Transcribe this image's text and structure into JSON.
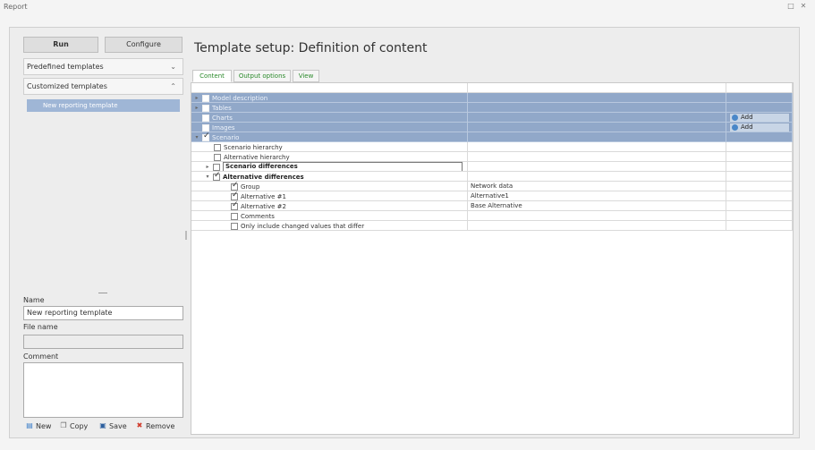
{
  "window": {
    "title": "Report",
    "restore_icon": "restore-icon",
    "close_icon": "close-icon"
  },
  "left": {
    "run_label": "Run",
    "configure_label": "Configure",
    "predefined_label": "Predefined templates",
    "customized_label": "Customized templates",
    "template_item": "New reporting template",
    "name_label": "Name",
    "name_value": "New reporting template",
    "filename_label": "File name",
    "filename_value": "",
    "comment_label": "Comment",
    "comment_value": "",
    "new_label": "New",
    "copy_label": "Copy",
    "save_label": "Save",
    "remove_label": "Remove"
  },
  "main": {
    "title": "Template setup: Definition of content",
    "tabs": [
      "Content",
      "Output options",
      "View"
    ],
    "add_label": "Add",
    "rows": [
      {
        "label": "Model description",
        "value": ""
      },
      {
        "label": "Tables",
        "value": ""
      },
      {
        "label": "Charts",
        "value": ""
      },
      {
        "label": "Images",
        "value": ""
      },
      {
        "label": "Scenario",
        "value": ""
      },
      {
        "label": "Scenario hierarchy",
        "value": ""
      },
      {
        "label": "Alternative hierarchy",
        "value": ""
      },
      {
        "label": "Scenario differences",
        "value": ""
      },
      {
        "label": "Alternative differences",
        "value": ""
      },
      {
        "label": "Group",
        "value": "Network data"
      },
      {
        "label": "Alternative #1",
        "value": "Alternative1"
      },
      {
        "label": "Alternative #2",
        "value": "Base Alternative"
      },
      {
        "label": "Comments",
        "value": ""
      },
      {
        "label": "Only include changed values that differ",
        "value": ""
      }
    ]
  }
}
